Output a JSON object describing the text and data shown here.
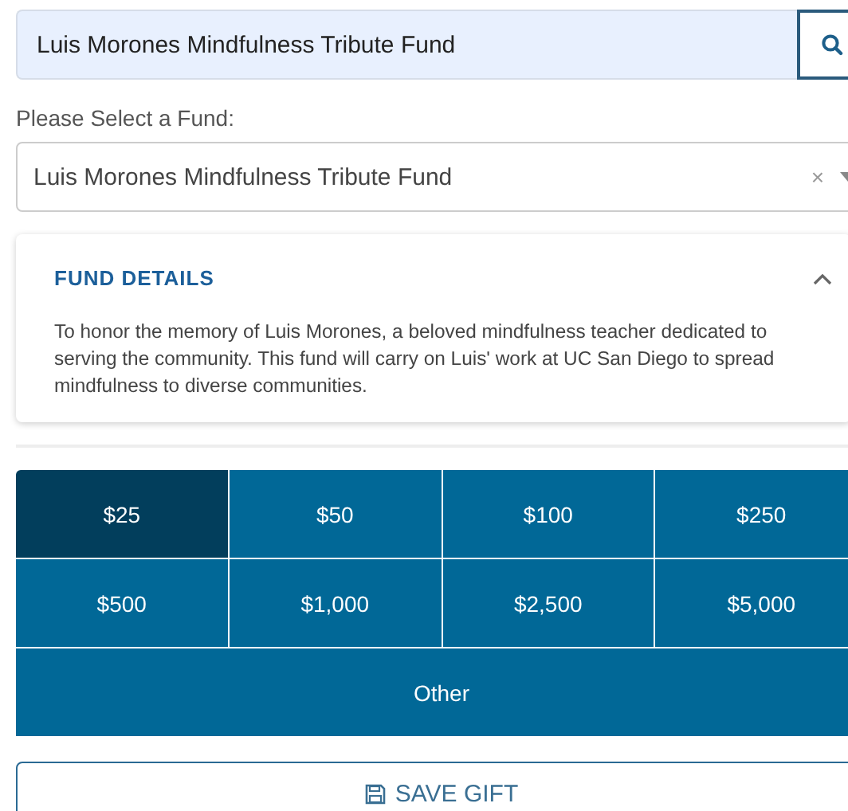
{
  "search": {
    "value": "Luis Morones Mindfulness Tribute Fund"
  },
  "fund_select": {
    "label": "Please Select a Fund:",
    "value": "Luis Morones Mindfulness Tribute Fund",
    "clear": "×"
  },
  "fund_details": {
    "title": "FUND DETAILS",
    "expanded": true,
    "description": "To honor the memory of Luis Morones, a beloved mindfulness teacher dedicated to serving the community. This fund will carry on Luis' work at UC San Diego to spread mindfulness to diverse communities."
  },
  "amounts": [
    {
      "label": "$25",
      "selected": true
    },
    {
      "label": "$50",
      "selected": false
    },
    {
      "label": "$100",
      "selected": false
    },
    {
      "label": "$250",
      "selected": false
    },
    {
      "label": "$500",
      "selected": false
    },
    {
      "label": "$1,000",
      "selected": false
    },
    {
      "label": "$2,500",
      "selected": false
    },
    {
      "label": "$5,000",
      "selected": false
    },
    {
      "label": "Other",
      "selected": false
    }
  ],
  "save_button": "SAVE GIFT"
}
